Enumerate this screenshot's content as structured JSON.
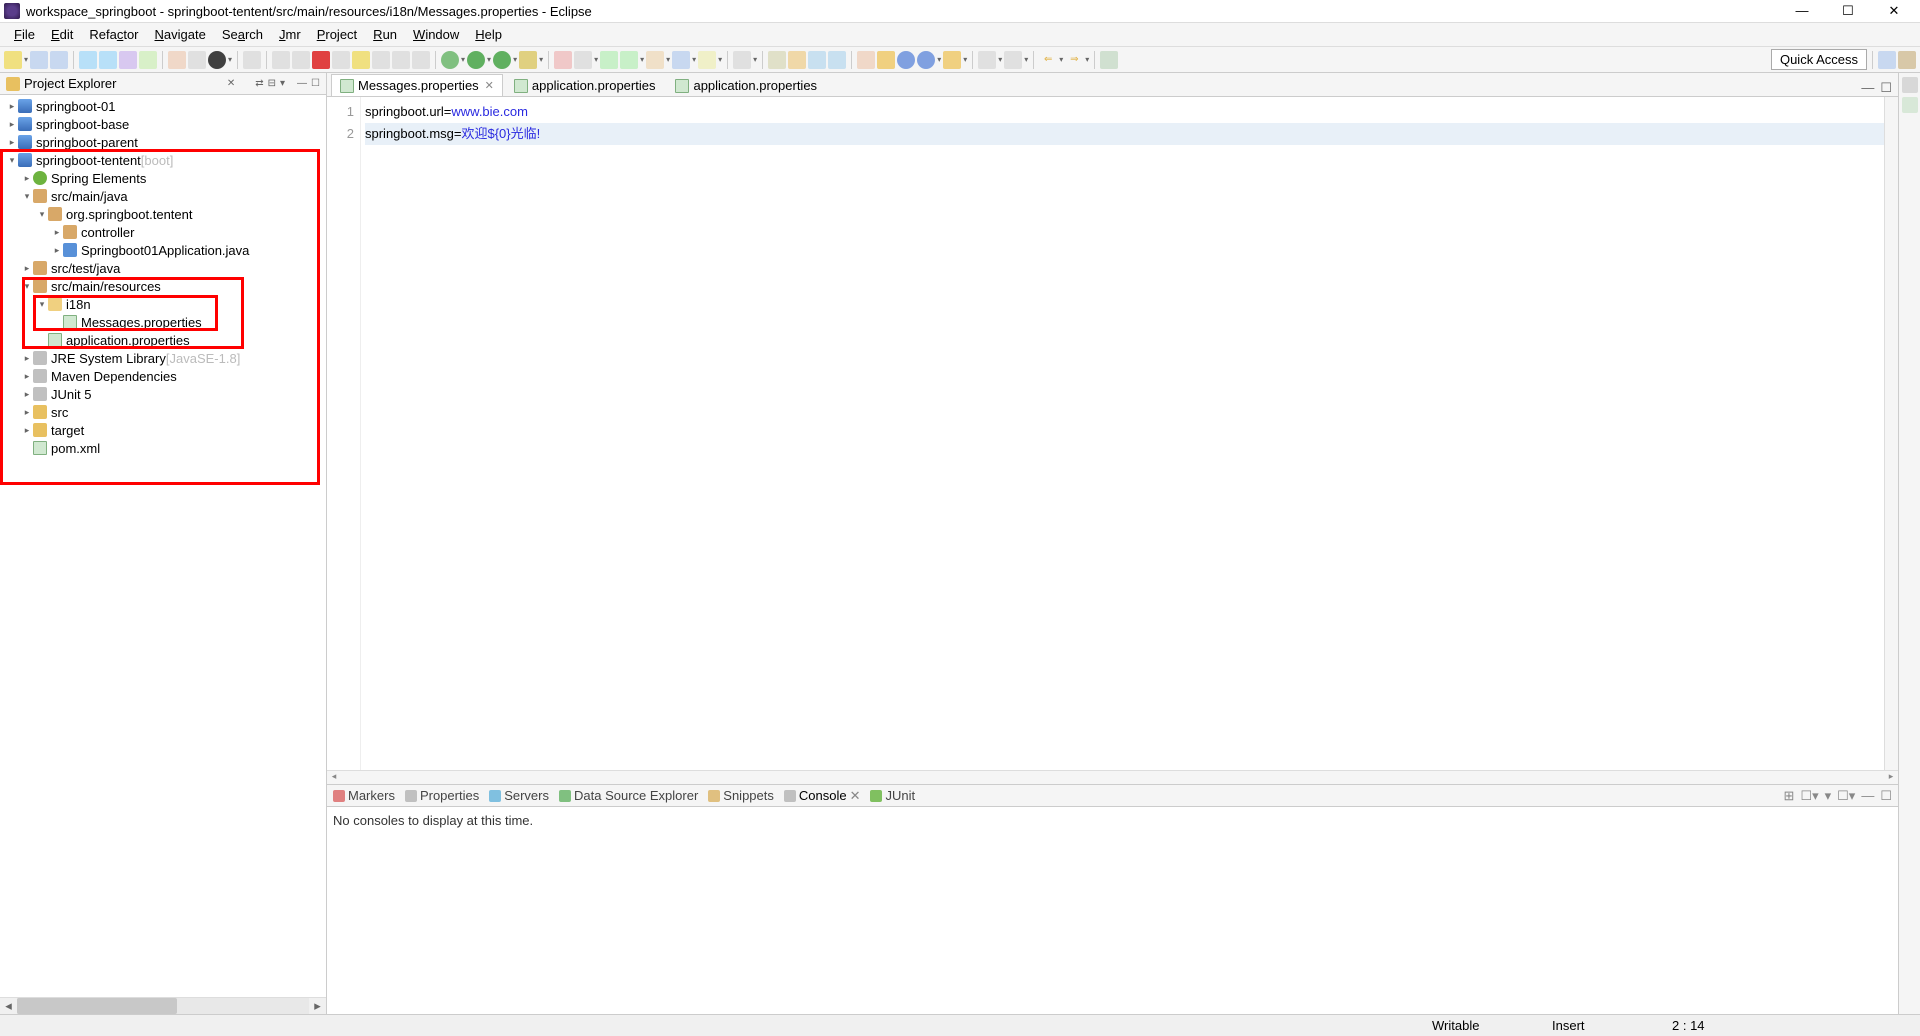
{
  "window": {
    "title": "workspace_springboot - springboot-tentent/src/main/resources/i18n/Messages.properties - Eclipse"
  },
  "menus": [
    "File",
    "Edit",
    "Refactor",
    "Navigate",
    "Search",
    "Jmr",
    "Project",
    "Run",
    "Window",
    "Help"
  ],
  "menu_mnemonic_index": [
    0,
    0,
    4,
    0,
    2,
    0,
    0,
    0,
    0,
    0
  ],
  "quick_access": "Quick Access",
  "project_explorer": {
    "title": "Project Explorer",
    "projects": [
      {
        "label": "springboot-01",
        "icon": "proj"
      },
      {
        "label": "springboot-base",
        "icon": "proj"
      },
      {
        "label": "springboot-parent",
        "icon": "proj"
      }
    ],
    "open_project": {
      "label": "springboot-tentent",
      "decor": "[boot]",
      "children": [
        {
          "indent": 1,
          "arrow": ">",
          "icon": "spring",
          "label": "Spring Elements"
        },
        {
          "indent": 1,
          "arrow": "v",
          "icon": "pkg",
          "label": "src/main/java"
        },
        {
          "indent": 2,
          "arrow": "v",
          "icon": "pkg",
          "label": "org.springboot.tentent"
        },
        {
          "indent": 3,
          "arrow": ">",
          "icon": "pkg",
          "label": "controller"
        },
        {
          "indent": 3,
          "arrow": ">",
          "icon": "java",
          "label": "Springboot01Application.java"
        },
        {
          "indent": 1,
          "arrow": ">",
          "icon": "pkg",
          "label": "src/test/java"
        },
        {
          "indent": 1,
          "arrow": "v",
          "icon": "pkg",
          "label": "src/main/resources"
        },
        {
          "indent": 2,
          "arrow": "v",
          "icon": "folder-open",
          "label": "i18n"
        },
        {
          "indent": 3,
          "arrow": "",
          "icon": "file",
          "label": "Messages.properties"
        },
        {
          "indent": 2,
          "arrow": "",
          "icon": "file",
          "label": "application.properties"
        },
        {
          "indent": 1,
          "arrow": ">",
          "icon": "lib",
          "label": "JRE System Library",
          "decor": "[JavaSE-1.8]"
        },
        {
          "indent": 1,
          "arrow": ">",
          "icon": "lib",
          "label": "Maven Dependencies"
        },
        {
          "indent": 1,
          "arrow": ">",
          "icon": "lib",
          "label": "JUnit 5"
        },
        {
          "indent": 1,
          "arrow": ">",
          "icon": "folder",
          "label": "src"
        },
        {
          "indent": 1,
          "arrow": ">",
          "icon": "folder",
          "label": "target"
        },
        {
          "indent": 1,
          "arrow": "",
          "icon": "file",
          "label": "pom.xml"
        }
      ]
    }
  },
  "editor": {
    "tabs": [
      {
        "label": "Messages.properties",
        "active": true,
        "icon": "file"
      },
      {
        "label": "application.properties",
        "active": false,
        "icon": "file"
      },
      {
        "label": "application.properties",
        "active": false,
        "icon": "file"
      }
    ],
    "lines": [
      {
        "n": "1",
        "key": "springboot.url=",
        "val": "www.bie.com",
        "current": false
      },
      {
        "n": "2",
        "key": "springboot.msg=",
        "val": "欢迎${0}光临!",
        "current": true
      }
    ]
  },
  "console": {
    "tabs": [
      "Markers",
      "Properties",
      "Servers",
      "Data Source Explorer",
      "Snippets",
      "Console",
      "JUnit"
    ],
    "active": "Console",
    "message": "No consoles to display at this time."
  },
  "status": {
    "writable": "Writable",
    "insert": "Insert",
    "pos": "2 : 14"
  }
}
